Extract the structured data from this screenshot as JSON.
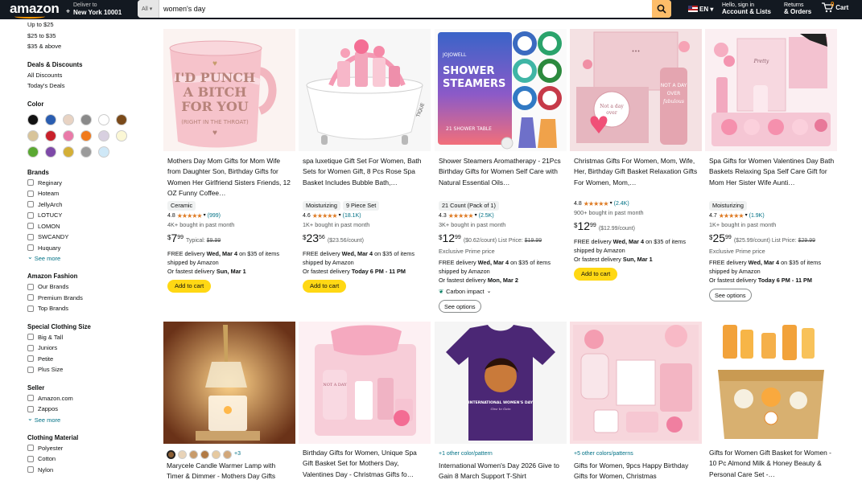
{
  "nav": {
    "logo": "amazon",
    "deliver_line1": "Deliver to",
    "deliver_line2": "New York 10001",
    "search_category": "All",
    "search_query": "women's day",
    "lang": "EN",
    "account_line1": "Hello, sign in",
    "account_line2": "Account & Lists",
    "orders_line1": "Returns",
    "orders_line2": "& Orders",
    "cart_label": "Cart",
    "cart_count": "0"
  },
  "sidebar": {
    "price_ranges": [
      "Up to $25",
      "$25 to $35",
      "$35 & above"
    ],
    "deals_heading": "Deals & Discounts",
    "deals": [
      "All Discounts",
      "Today's Deals"
    ],
    "color_heading": "Color",
    "colors": [
      "#111111",
      "#2a5db0",
      "#e8d3c3",
      "#8a8a8a",
      "#ffffff",
      "#7a4a1a",
      "#d8c49a",
      "#c8202a",
      "#e97aa8",
      "#f07a1c",
      "#d8d0e0",
      "#fbf7d5",
      "#5aa832",
      "#7e49a8",
      "#d4af37",
      "#9b9b9b",
      "#cfe8f7"
    ],
    "brands_heading": "Brands",
    "brands": [
      "Reginary",
      "Hoteam",
      "JellyArch",
      "LOTUCY",
      "LOMON",
      "SWCANDY",
      "Huquary"
    ],
    "see_more": "See more",
    "fashion_heading": "Amazon Fashion",
    "fashion": [
      "Our Brands",
      "Premium Brands",
      "Top Brands"
    ],
    "special_heading": "Special Clothing Size",
    "special": [
      "Big & Tall",
      "Juniors",
      "Petite",
      "Plus Size"
    ],
    "seller_heading": "Seller",
    "sellers": [
      "Amazon.com",
      "Zappos"
    ],
    "material_heading": "Clothing Material",
    "materials": [
      "Polyester",
      "Cotton",
      "Nylon"
    ]
  },
  "products": [
    {
      "title": "Mothers Day Mom Gifts for Mom Wife from Daughter Son, Birthday Gifts for Women Her Girlfriend Sisters Friends, 12 OZ Funny Coffee…",
      "badges": [
        "Ceramic"
      ],
      "rating": "4.8",
      "reviews": "(999)",
      "bought": "4K+ bought in past month",
      "price_symbol": "$",
      "price_whole": "7",
      "price_fraction": "99",
      "price_extra": "Typical:",
      "price_list": "$9.99",
      "note": "",
      "delivery1_pre": "FREE delivery ",
      "delivery1_date": "Wed, Mar 4",
      "delivery1_post": " on $35 of items shipped by Amazon",
      "delivery2_pre": "Or fastest delivery ",
      "delivery2_date": "Sun, Mar 1",
      "button": "Add to cart"
    },
    {
      "title": "spa luxetique Gift Set For Women, Bath Sets for Women Gift, 8 Pcs Rose Spa Basket Includes Bubble Bath,…",
      "badges": [
        "Moisturizing",
        "9 Piece Set"
      ],
      "rating": "4.6",
      "reviews": "(18.1K)",
      "bought": "1K+ bought in past month",
      "price_symbol": "$",
      "price_whole": "23",
      "price_fraction": "56",
      "price_extra": "($23.56/count)",
      "price_list": "",
      "note": "",
      "delivery1_pre": "FREE delivery ",
      "delivery1_date": "Wed, Mar 4",
      "delivery1_post": " on $35 of items shipped by Amazon",
      "delivery2_pre": "Or fastest delivery ",
      "delivery2_date": "Today 6 PM - 11 PM",
      "button": "Add to cart"
    },
    {
      "title": "Shower Steamers Aromatherapy - 21Pcs Birthday Gifts for Women Self Care with Natural Essential Oils…",
      "badges": [
        "21 Count (Pack of 1)"
      ],
      "rating": "4.3",
      "reviews": "(2.5K)",
      "bought": "3K+ bought in past month",
      "price_symbol": "$",
      "price_whole": "12",
      "price_fraction": "99",
      "price_extra": "($0.62/count) List Price:",
      "price_list": "$19.99",
      "note": "Exclusive Prime price",
      "delivery1_pre": "FREE delivery ",
      "delivery1_date": "Wed, Mar 4",
      "delivery1_post": " on $35 of items shipped by Amazon",
      "delivery2_pre": "Or fastest delivery ",
      "delivery2_date": "Mon, Mar 2",
      "carbon": "Carbon impact",
      "button": "See options"
    },
    {
      "title": "Christmas Gifts For Women, Mom, Wife, Her, Birthday Gift Basket Relaxation Gifts For Women, Mom,…",
      "badges": [],
      "rating": "4.8",
      "reviews": "(2.4K)",
      "bought": "900+ bought in past month",
      "price_symbol": "$",
      "price_whole": "12",
      "price_fraction": "99",
      "price_extra": "($12.99/count)",
      "price_list": "",
      "note": "",
      "delivery1_pre": "FREE delivery ",
      "delivery1_date": "Wed, Mar 4",
      "delivery1_post": " on $35 of items shipped by Amazon",
      "delivery2_pre": "Or fastest delivery ",
      "delivery2_date": "Sun, Mar 1",
      "button": "Add to cart"
    },
    {
      "title": "Spa Gifts for Women Valentines Day Bath Baskets Relaxing Spa Self Care Gift for Mom Her Sister Wife Aunti…",
      "badges": [
        "Moisturizing"
      ],
      "rating": "4.7",
      "reviews": "(1.9K)",
      "bought": "1K+ bought in past month",
      "price_symbol": "$",
      "price_whole": "25",
      "price_fraction": "99",
      "price_extra": "($25.99/count) List Price:",
      "price_list": "$29.99",
      "note": "Exclusive Prime price",
      "delivery1_pre": "FREE delivery ",
      "delivery1_date": "Wed, Mar 4",
      "delivery1_post": " on $35 of items shipped by Amazon",
      "delivery2_pre": "Or fastest delivery ",
      "delivery2_date": "Today 6 PM - 11 PM",
      "button": "See options"
    }
  ],
  "products_row2": [
    {
      "colors_extra": "+3",
      "title": "Marycele Candle Warmer Lamp with Timer & Dimmer - Mothers Day Gifts"
    },
    {
      "colors_extra": "",
      "title": "Birthday Gifts for Women, Unique Spa Gift Basket Set for Mothers Day, Valentines Day - Christmas Gifts fo…"
    },
    {
      "colors_extra": "+1 other color/pattern",
      "title": "International Women's Day 2026 Give to Gain 8 March Support T-Shirt"
    },
    {
      "colors_extra": "+5 other colors/patterns",
      "title": "Gifts for Women, 9pcs Happy Birthday Gifts for Women, Christmas"
    },
    {
      "colors_extra": "",
      "title": "Gifts for Women Gift Basket for Women - 10 Pc Almond Milk & Honey Beauty & Personal Care Set -…"
    }
  ],
  "images": {
    "mug_text": "I'D PUNCH A BITCH FOR YOU",
    "mug_sub": "(RIGHT IN THE THROAT)",
    "steamer_brand": "JOJOWELL",
    "steamer_title": "SHOWER STEAMERS",
    "steamer_sub": "21 SHOWER TABLE",
    "gift_tumbler": "NOT A DAY OVER fabulous",
    "shirt_text": "INTERNATIONAL WOMEN'S DAY"
  }
}
